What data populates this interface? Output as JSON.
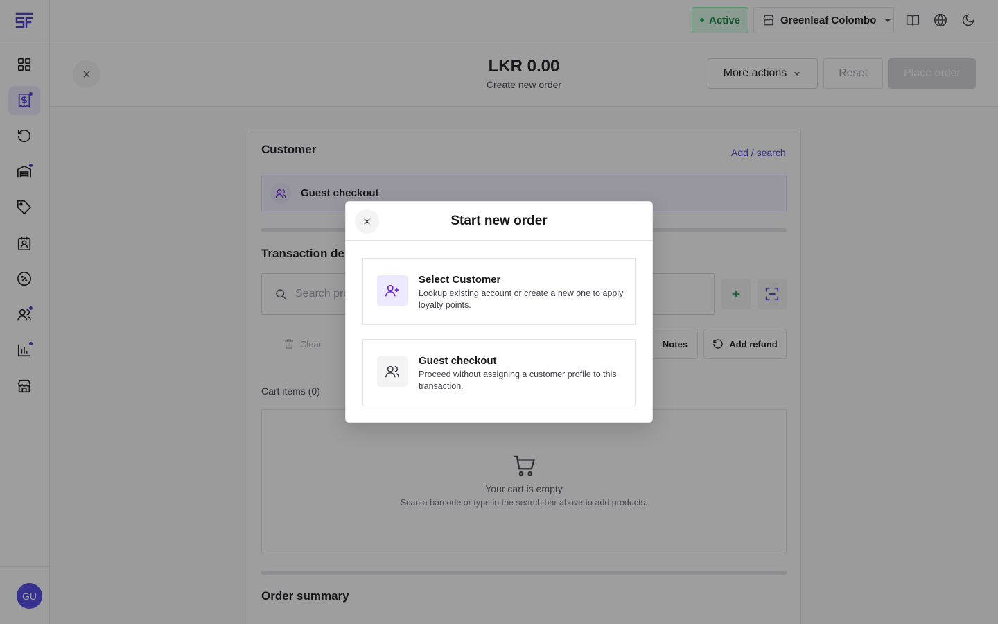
{
  "header": {
    "status": "Active",
    "store": "Greenleaf Colombo",
    "icons": [
      "book-open-icon",
      "globe-icon",
      "moon-icon"
    ]
  },
  "sidebar": {
    "logo": "sf-logo",
    "items": [
      {
        "name": "dashboard",
        "icon": "grid-icon",
        "active": false,
        "dot": false
      },
      {
        "name": "orders",
        "icon": "receipt-dollar-icon",
        "active": true,
        "dot": true
      },
      {
        "name": "refunds",
        "icon": "rotate-ccw-icon",
        "active": false,
        "dot": false
      },
      {
        "name": "warehouse",
        "icon": "warehouse-icon",
        "active": false,
        "dot": true
      },
      {
        "name": "products",
        "icon": "tag-icon",
        "active": false,
        "dot": false
      },
      {
        "name": "contacts",
        "icon": "contact-icon",
        "active": false,
        "dot": false
      },
      {
        "name": "discounts",
        "icon": "percent-badge-icon",
        "active": false,
        "dot": false
      },
      {
        "name": "customers",
        "icon": "users-icon",
        "active": false,
        "dot": true
      },
      {
        "name": "reports",
        "icon": "bar-chart-icon",
        "active": false,
        "dot": true
      },
      {
        "name": "stores",
        "icon": "store-icon",
        "active": false,
        "dot": false
      }
    ],
    "avatar_initials": "GU"
  },
  "titlebar": {
    "total": "LKR 0.00",
    "subtitle": "Create new order",
    "more_actions": "More actions",
    "reset": "Reset",
    "place_order": "Place order"
  },
  "customer": {
    "title": "Customer",
    "add_search": "Add / search",
    "guest_label": "Guest checkout"
  },
  "transaction": {
    "title": "Transaction de",
    "search_placeholder": "Search prod",
    "clear": "Clear",
    "notes": "Notes",
    "add_refund": "Add refund"
  },
  "cart": {
    "label": "Cart items (0)",
    "empty_title": "Your cart is empty",
    "empty_desc": "Scan a barcode or type in the search bar above to add products."
  },
  "order_summary": {
    "title": "Order summary"
  },
  "modal": {
    "title": "Start new order",
    "options": [
      {
        "title": "Select Customer",
        "desc": "Lookup existing account or create a new one to apply loyalty points.",
        "icon": "user-plus-icon"
      },
      {
        "title": "Guest checkout",
        "desc": "Proceed without assigning a customer profile to this transaction.",
        "icon": "users-icon"
      }
    ]
  },
  "colors": {
    "accent": "#4338ca",
    "active_green": "#15803d",
    "border": "#e4e4e7"
  }
}
